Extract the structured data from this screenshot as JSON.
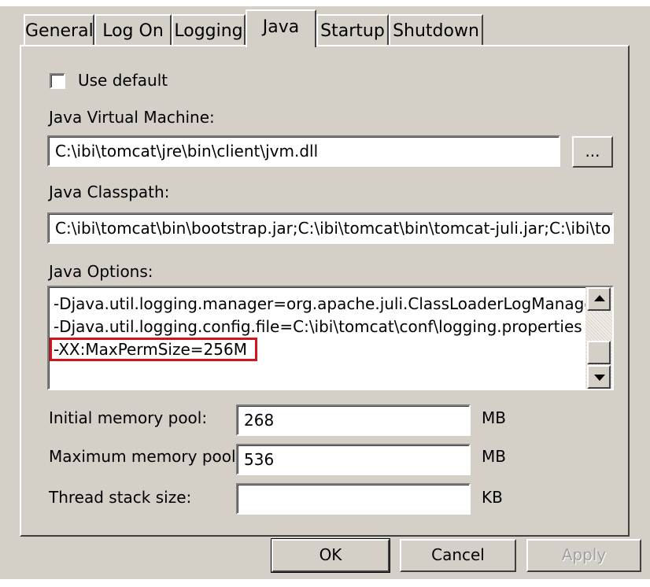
{
  "tabs": [
    {
      "label": "General",
      "active": false
    },
    {
      "label": "Log On",
      "active": false
    },
    {
      "label": "Logging",
      "active": false
    },
    {
      "label": "Java",
      "active": true
    },
    {
      "label": "Startup",
      "active": false
    },
    {
      "label": "Shutdown",
      "active": false
    }
  ],
  "use_default": {
    "label": "Use default",
    "checked": false
  },
  "jvm": {
    "label": "Java Virtual Machine:",
    "value": "C:\\ibi\\tomcat\\jre\\bin\\client\\jvm.dll",
    "browse_label": "..."
  },
  "classpath": {
    "label": "Java Classpath:",
    "value": "C:\\ibi\\tomcat\\bin\\bootstrap.jar;C:\\ibi\\tomcat\\bin\\tomcat-juli.jar;C:\\ibi\\tom"
  },
  "java_options": {
    "label": "Java Options:",
    "lines": [
      "-Djava.util.logging.manager=org.apache.juli.ClassLoaderLogManagei",
      "-Djava.util.logging.config.file=C:\\ibi\\tomcat\\conf\\logging.properties",
      "-XX:MaxPermSize=256M"
    ],
    "highlight_color": "#d4141c"
  },
  "initial_memory": {
    "label": "Initial memory pool:",
    "value": "268",
    "unit": "MB"
  },
  "maximum_memory": {
    "label": "Maximum memory pool:",
    "value": "536",
    "unit": "MB"
  },
  "thread_stack": {
    "label": "Thread stack size:",
    "value": "",
    "unit": "KB"
  },
  "buttons": {
    "ok": "OK",
    "cancel": "Cancel",
    "apply": "Apply"
  }
}
